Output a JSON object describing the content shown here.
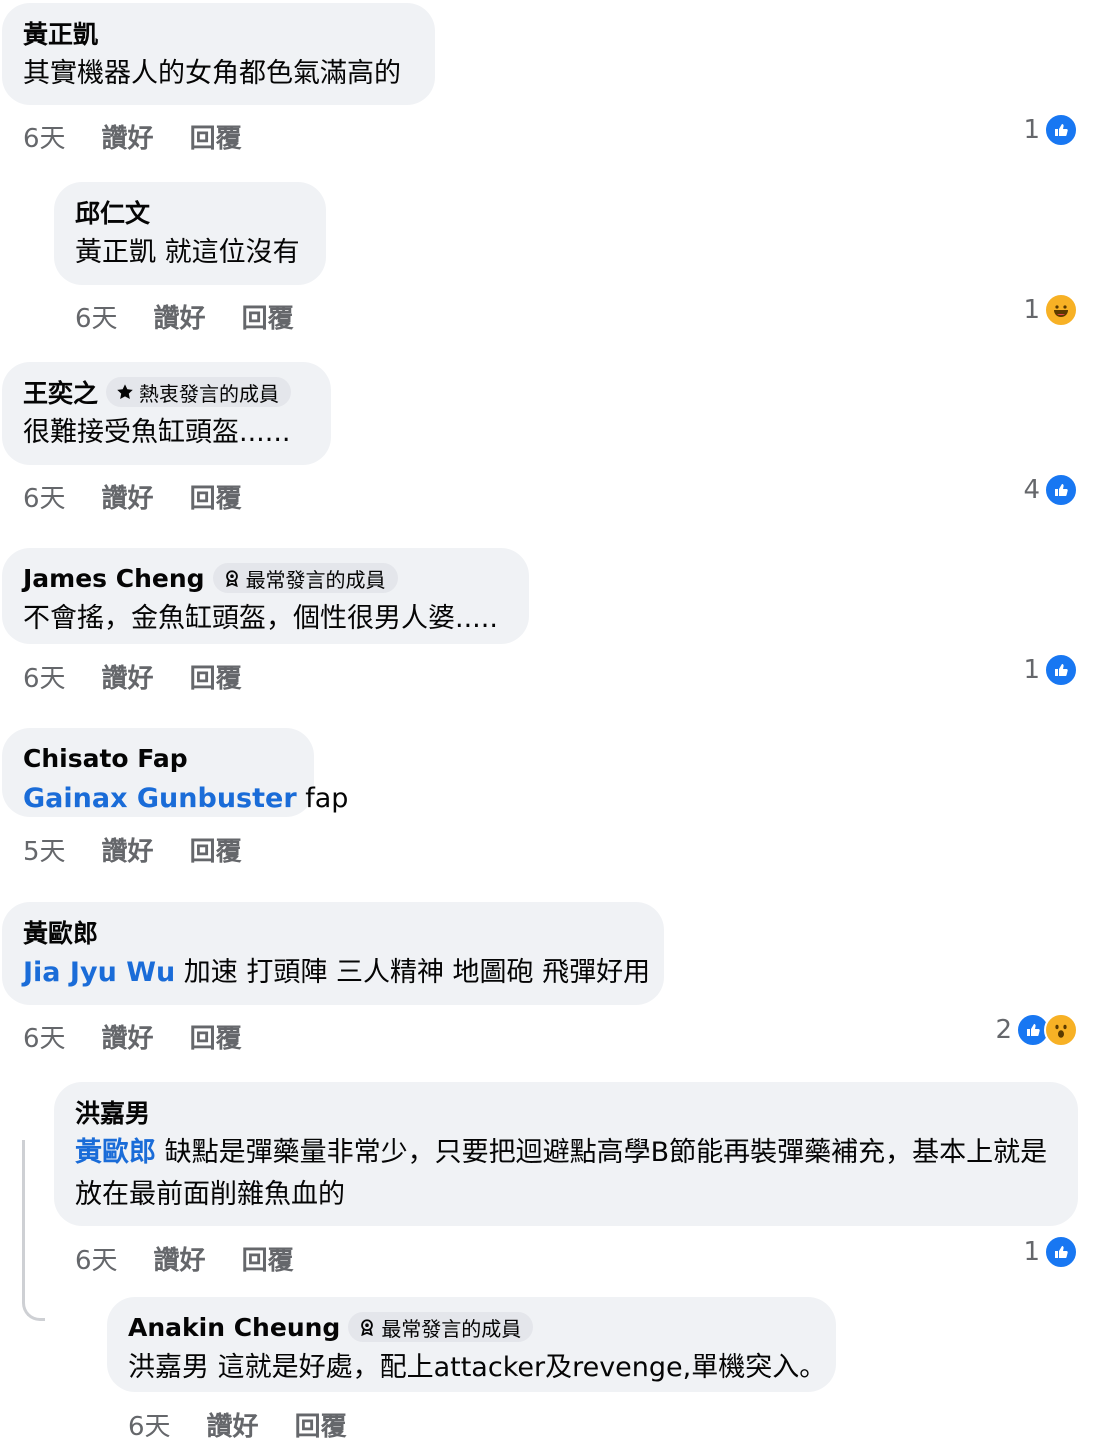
{
  "comments": [
    {
      "author": "黃正凱",
      "text": "其實機器人的女角都色氣滿高的",
      "time": "6天",
      "like": "讚好",
      "reply": "回覆",
      "reaction_count": "1",
      "reactions": [
        "like-icon"
      ]
    },
    {
      "author": "邱仁文",
      "text": "黃正凱 就這位沒有",
      "time": "6天",
      "like": "讚好",
      "reply": "回覆",
      "reaction_count": "1",
      "reactions": [
        "haha-icon"
      ]
    },
    {
      "author": "王奕之",
      "badge": "熱衷發言的成員",
      "badge_icon": "star-icon",
      "text": "很難接受魚缸頭盔......",
      "time": "6天",
      "like": "讚好",
      "reply": "回覆",
      "reaction_count": "4",
      "reactions": [
        "like-icon"
      ]
    },
    {
      "author": "James Cheng",
      "badge": "最常發言的成員",
      "badge_icon": "medal-icon",
      "text": "不會搖，金魚缸頭盔，個性很男人婆.....",
      "time": "6天",
      "like": "讚好",
      "reply": "回覆",
      "reaction_count": "1",
      "reactions": [
        "like-icon"
      ]
    },
    {
      "author": "Chisato Fap",
      "mention": "Gainax Gunbuster",
      "text": " fap",
      "time": "5天",
      "like": "讚好",
      "reply": "回覆"
    },
    {
      "author": "黃歐郎",
      "mention": "Jia Jyu Wu",
      "text": " 加速 打頭陣 三人精神 地圖砲 飛彈好用",
      "time": "6天",
      "like": "讚好",
      "reply": "回覆",
      "reaction_count": "2",
      "reactions": [
        "like-icon",
        "wow-icon"
      ]
    },
    {
      "author": "洪嘉男",
      "mention": "黃歐郎",
      "text": " 缺點是彈藥量非常少，只要把迴避點高學B節能再裝彈藥補充，基本上就是放在最前面削雜魚血的",
      "time": "6天",
      "like": "讚好",
      "reply": "回覆",
      "reaction_count": "1",
      "reactions": [
        "like-icon"
      ]
    },
    {
      "author": "Anakin Cheung",
      "badge": "最常發言的成員",
      "badge_icon": "medal-icon",
      "text": "洪嘉男 這就是好處，配上attacker及revenge,單機突入。",
      "time": "6天",
      "like": "讚好",
      "reply": "回覆"
    }
  ],
  "colors": {
    "bubble": "#f0f2f5",
    "mention": "#1a6cd8",
    "like": "#1877f2",
    "meta": "#65676b"
  }
}
